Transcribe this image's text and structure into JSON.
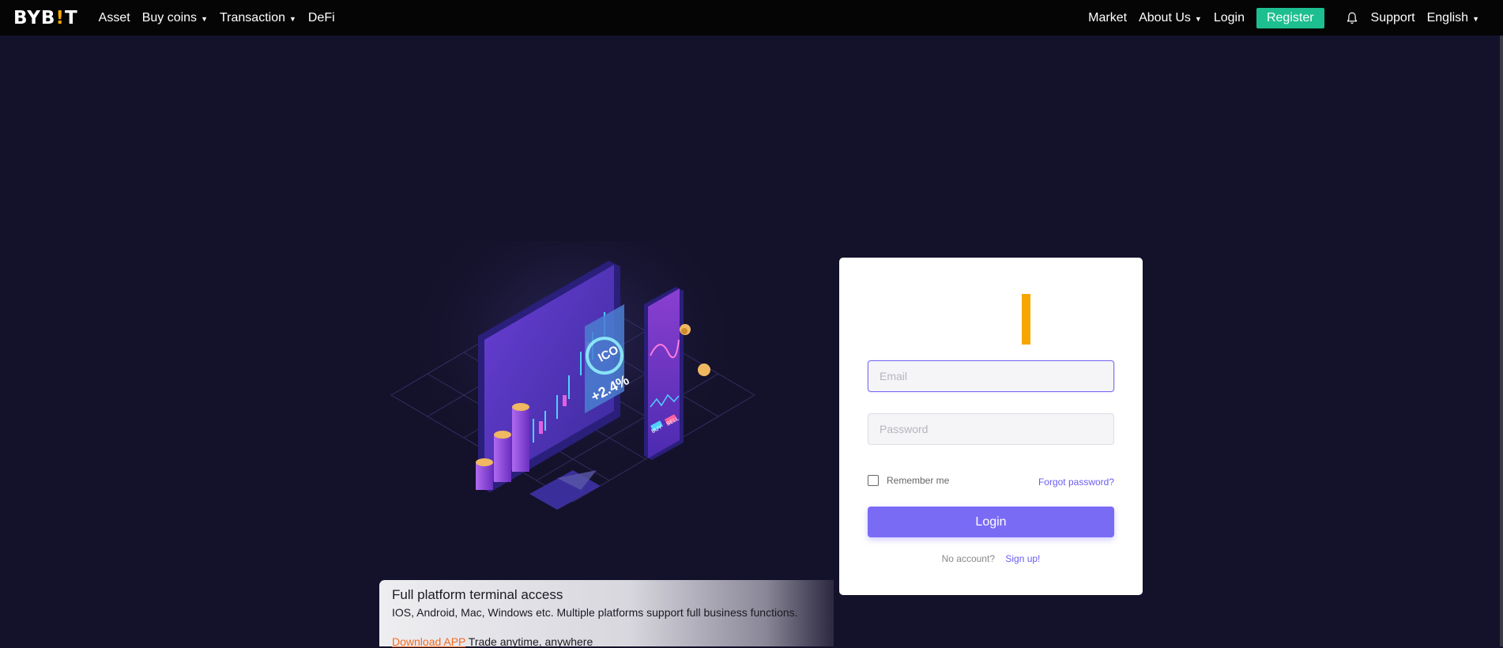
{
  "header": {
    "logo": {
      "part1": "BYB",
      "bang": "!",
      "part2": "T"
    },
    "nav_left": {
      "asset": "Asset",
      "buy_coins": "Buy coins",
      "transaction": "Transaction",
      "defi": "DeFi"
    },
    "nav_right": {
      "market": "Market",
      "about_us": "About Us",
      "login": "Login",
      "register": "Register",
      "support": "Support",
      "language": "English"
    }
  },
  "illustration": {
    "badge_title": "ICO",
    "badge_value": "+2.4%",
    "phone_buy": "BUY",
    "phone_sell": "SELL"
  },
  "login_form": {
    "email_placeholder": "Email",
    "password_placeholder": "Password",
    "remember_me": "Remember me",
    "forgot_password": "Forgot password?",
    "login_button": "Login",
    "no_account": "No account?",
    "sign_up": "Sign up!"
  },
  "promo": {
    "title": "Full platform terminal access",
    "description": "IOS, Android, Mac, Windows etc. Multiple platforms support full business functions.",
    "download_link": "Download APP",
    "tagline": "Trade anytime, anywhere"
  },
  "colors": {
    "background": "#14112a",
    "topbar": "#050506",
    "brand_yellow": "#f7a600",
    "register_green": "#1dbf90",
    "primary_purple": "#7a6bf5",
    "download_orange": "#f26b21"
  },
  "icons": [
    "bell-icon",
    "caret-down-icon",
    "checkbox-icon"
  ]
}
